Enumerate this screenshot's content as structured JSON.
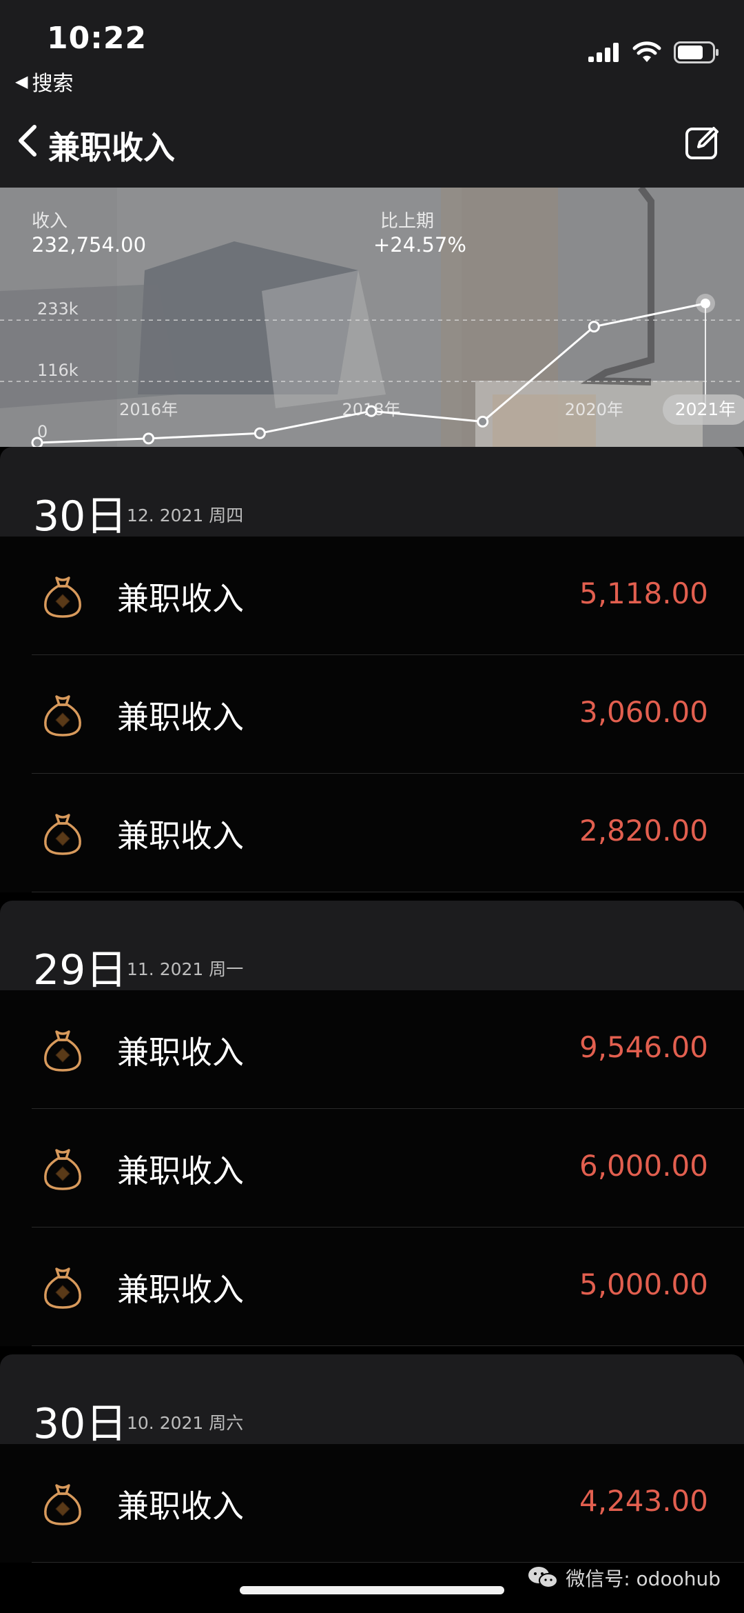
{
  "status_bar": {
    "time": "10:22",
    "back_label": "搜索"
  },
  "nav": {
    "title": "兼职收入"
  },
  "stats": {
    "income_label": "收入",
    "income_value": "232,754.00",
    "compare_label": "比上期",
    "compare_value": "+24.57%"
  },
  "chart_data": {
    "type": "line",
    "y_tick_labels": [
      "233k",
      "116k",
      "0"
    ],
    "x_tick_labels": [
      "2016年",
      "2018年",
      "2020年",
      "2021年"
    ],
    "selected_x_label": "2021年",
    "x": [
      "2015",
      "2016",
      "2017",
      "2018",
      "2019",
      "2020",
      "2021"
    ],
    "values": [
      0,
      8000,
      18000,
      60000,
      40000,
      220000,
      264000
    ],
    "ylim": [
      0,
      264000
    ],
    "grid": true,
    "colors": {
      "line": "#ffffff",
      "grid": "#e0e0e0"
    }
  },
  "sections": [
    {
      "day": "30日",
      "meta": "12. 2021  周四",
      "items": [
        {
          "name": "兼职收入",
          "amount": "5,118.00"
        },
        {
          "name": "兼职收入",
          "amount": "3,060.00"
        },
        {
          "name": "兼职收入",
          "amount": "2,820.00"
        }
      ]
    },
    {
      "day": "29日",
      "meta": "11. 2021  周一",
      "items": [
        {
          "name": "兼职收入",
          "amount": "9,546.00"
        },
        {
          "name": "兼职收入",
          "amount": "6,000.00"
        },
        {
          "name": "兼职收入",
          "amount": "5,000.00"
        }
      ]
    },
    {
      "day": "30日",
      "meta": "10. 2021  周六",
      "items": [
        {
          "name": "兼职收入",
          "amount": "4,243.00"
        }
      ]
    }
  ],
  "colors": {
    "amount": "#e25f4f",
    "icon_accent": "#d89a5c",
    "background": "#000000",
    "header": "#1c1c1e"
  },
  "icons": {
    "row_icon": "money-bag-icon"
  },
  "watermark": {
    "text": "微信号: odoohub"
  }
}
